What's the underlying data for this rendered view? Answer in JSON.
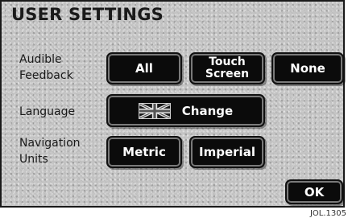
{
  "screen": {
    "title": "USER SETTINGS"
  },
  "audible_feedback": {
    "label_line1": "Audible",
    "label_line2": "Feedback",
    "options": [
      "All",
      "Touch",
      "Screen",
      "None"
    ]
  },
  "language": {
    "label": "Language",
    "change_label": "Change",
    "flag_icon": "union-jack-flag-icon"
  },
  "navigation_units": {
    "label_line1": "Navigation",
    "label_line2": "Units",
    "options": [
      "Metric",
      "Imperial"
    ]
  },
  "ok_label": "OK",
  "reference_code": "JOL.1305"
}
